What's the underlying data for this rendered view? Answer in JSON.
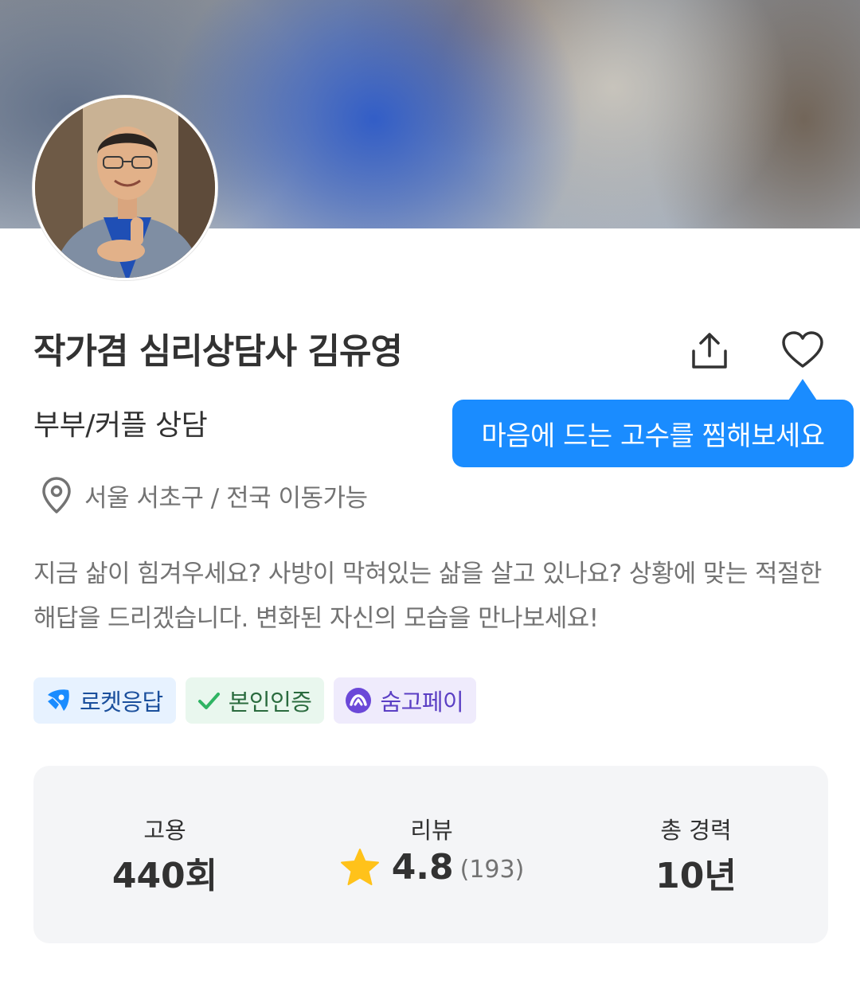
{
  "profile": {
    "name": "작가겸 심리상담사 김유영",
    "category": "부부/커플 상담",
    "location": "서울 서초구 / 전국 이동가능",
    "intro": "지금 삶이 힘겨우세요? 사방이 막혀있는 삶을 살고 있나요? 상황에 맞는 적절한 해답을 드리겠습니다. 변화된 자신의 모습을 만나보세요!"
  },
  "actions": {
    "share_icon": "share-icon",
    "heart_icon": "heart-icon"
  },
  "tooltip": {
    "text": "마음에 드는 고수를 찜해보세요"
  },
  "badges": [
    {
      "label": "로켓응답",
      "icon": "rocket-icon",
      "color": "#1a8cff"
    },
    {
      "label": "본인인증",
      "icon": "check-icon",
      "color": "#2fb463"
    },
    {
      "label": "숨고페이",
      "icon": "soomgo-pay-icon",
      "color": "#6b48d8"
    }
  ],
  "stats": {
    "hire_label": "고용",
    "hire_value": "440회",
    "review_label": "리뷰",
    "review_rating": "4.8",
    "review_count": "(193)",
    "career_label": "총 경력",
    "career_value": "10년"
  },
  "colors": {
    "accent": "#1a8cff",
    "star": "#ffc21a",
    "text_primary": "#323232",
    "text_secondary": "#737373"
  }
}
